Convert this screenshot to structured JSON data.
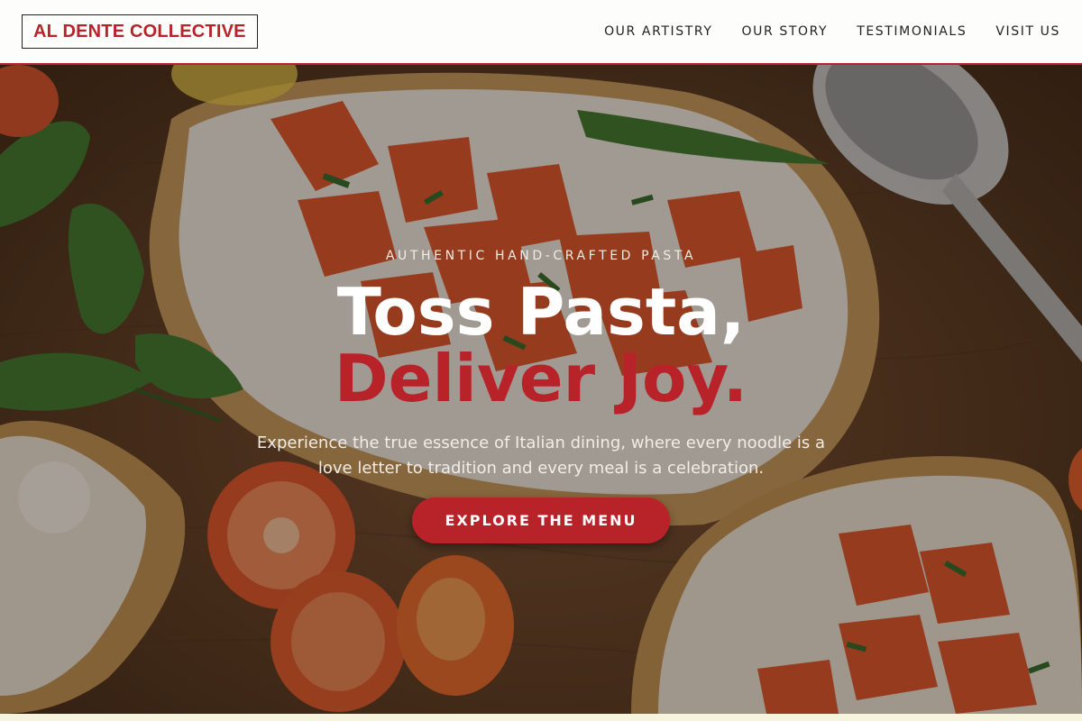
{
  "header": {
    "logo": "AL DENTE COLLECTIVE",
    "nav": [
      "OUR ARTISTRY",
      "OUR STORY",
      "TESTIMONIALS",
      "VISIT US"
    ]
  },
  "hero": {
    "kicker": "AUTHENTIC HAND-CRAFTED PASTA",
    "title_line1": "Toss Pasta,",
    "title_line2": "Deliver Joy.",
    "subtitle": "Experience the true essence of Italian dining, where every noodle is a love letter to tradition and every meal is a celebration.",
    "cta_label": "EXPLORE THE MENU",
    "background": "bruschetta-with-tomatoes-photo"
  },
  "colors": {
    "accent": "#b8232a",
    "header_bg": "#fdfdfb",
    "text_dark": "#222222"
  }
}
